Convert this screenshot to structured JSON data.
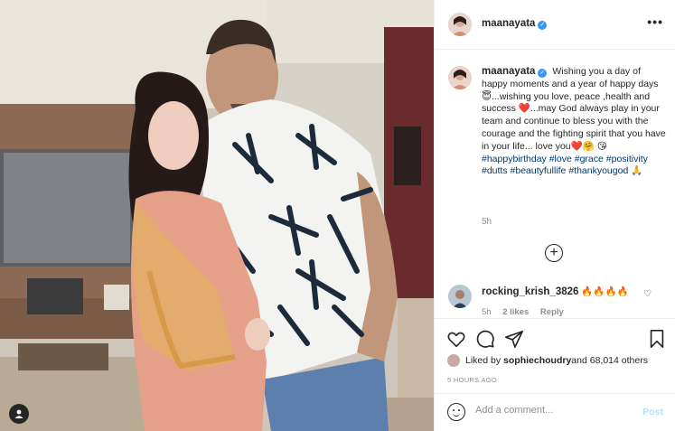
{
  "post": {
    "author": "maanayata",
    "verified": true
  },
  "caption": {
    "text": "Wishing you a day of happy moments and a year of happy days😇...wishing you love, peace ,health and success ❤️...may God always play in your team and continue to bless you with the courage and the fighting spirit that you have in your life... love you❤️🤗 😘",
    "hashtags": "#happybirthday #love #grace #positivity #dutts #beautyfullife #thankyougod 🙏",
    "time": "5h"
  },
  "comment": {
    "user": "rocking_krish_3826",
    "text": "🔥🔥🔥🔥",
    "time": "5h",
    "likes": "2 likes",
    "reply": "Reply"
  },
  "likes": {
    "prefix": "Liked by ",
    "user": "sophiechoudry",
    "suffix": " and 68,014 others"
  },
  "timestamp": "5 HOURS AGO",
  "add_comment": {
    "placeholder": "Add a comment...",
    "post_label": "Post"
  },
  "icons": {
    "more": "more-icon",
    "load_more": "plus-circle-icon",
    "like": "heart-icon",
    "comment": "comment-icon",
    "share": "paper-plane-icon",
    "save": "bookmark-icon",
    "tag": "user-tag-icon",
    "emoji": "emoji-icon"
  },
  "colors": {
    "link": "#00376b",
    "verified": "#3897f0",
    "muted": "#8e8e8e",
    "post_disabled": "#b2dffc"
  }
}
